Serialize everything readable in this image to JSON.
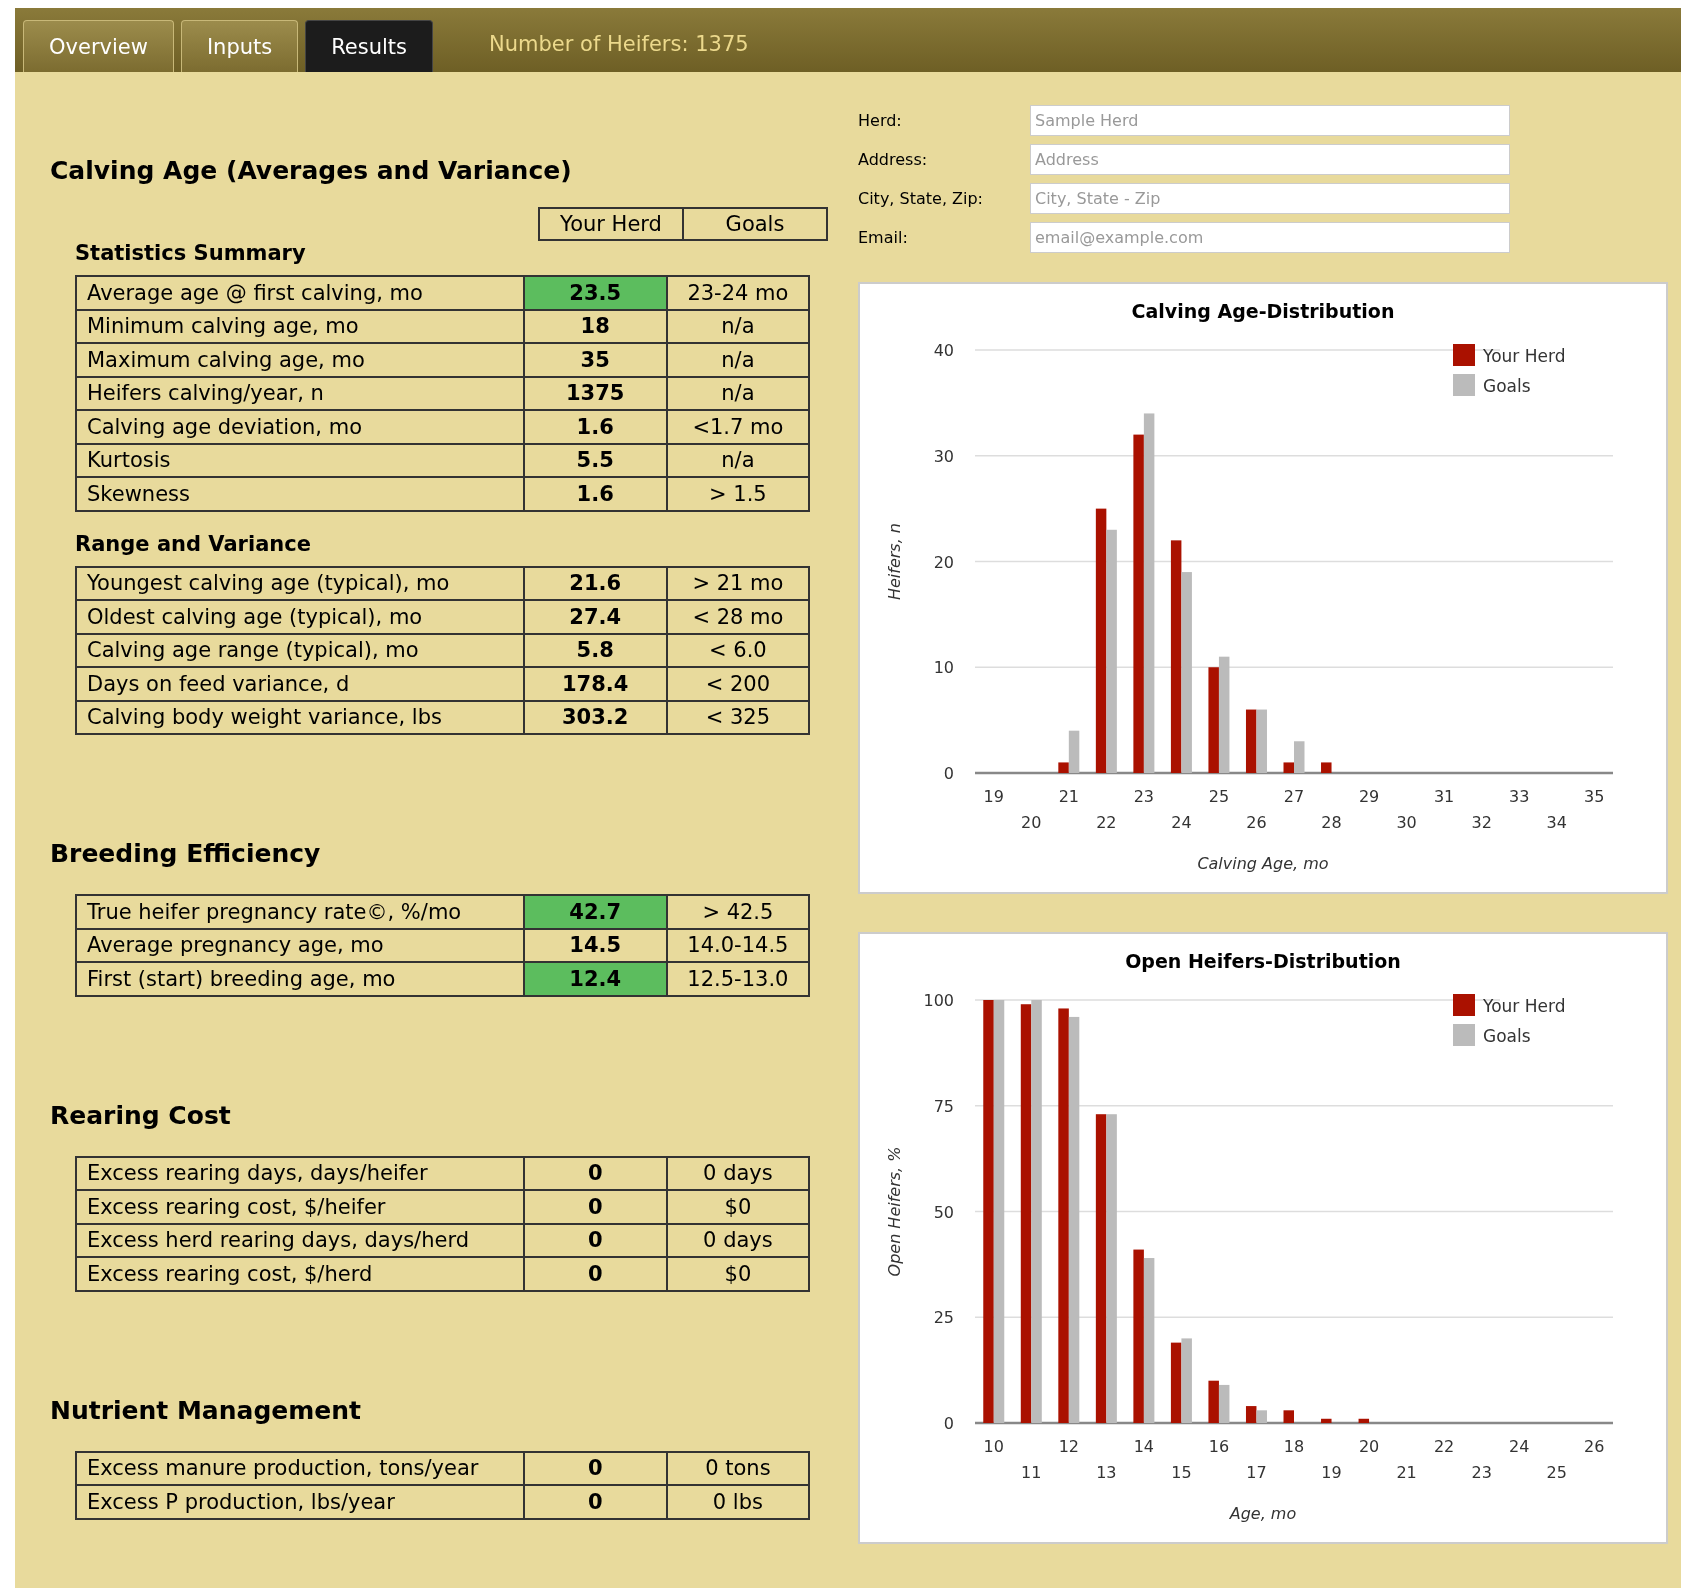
{
  "tabs": [
    {
      "label": "Overview",
      "selected": false
    },
    {
      "label": "Inputs",
      "selected": false
    },
    {
      "label": "Results",
      "selected": true
    }
  ],
  "heifer_count": "Number of Heifers: 1375",
  "form": {
    "fields": [
      {
        "label": "Herd:",
        "placeholder": "Sample Herd"
      },
      {
        "label": "Address:",
        "placeholder": "Address"
      },
      {
        "label": "City, State, Zip:",
        "placeholder": "City, State - Zip"
      },
      {
        "label": "Email:",
        "placeholder": "email@example.com"
      }
    ]
  },
  "column_headers": [
    "Your Herd",
    "Goals"
  ],
  "sections": [
    {
      "title": "Calving Age (Averages and Variance)",
      "groups": [
        {
          "subtitle": "Statistics Summary",
          "rows": [
            {
              "label": "Average age @ first calving, mo",
              "value": "23.5",
              "goal": "23-24 mo",
              "highlight": true
            },
            {
              "label": "Minimum calving age, mo",
              "value": "18",
              "goal": "n/a",
              "highlight": false
            },
            {
              "label": "Maximum calving age, mo",
              "value": "35",
              "goal": "n/a",
              "highlight": false
            },
            {
              "label": "Heifers calving/year, n",
              "value": "1375",
              "goal": "n/a",
              "highlight": false
            },
            {
              "label": "Calving age deviation, mo",
              "value": "1.6",
              "goal": "<1.7 mo",
              "highlight": false
            },
            {
              "label": "Kurtosis",
              "value": "5.5",
              "goal": "n/a",
              "highlight": false
            },
            {
              "label": "Skewness",
              "value": "1.6",
              "goal": "> 1.5",
              "highlight": false
            }
          ]
        },
        {
          "subtitle": "Range and Variance",
          "rows": [
            {
              "label": "Youngest calving age (typical), mo",
              "value": "21.6",
              "goal": "> 21 mo",
              "highlight": false
            },
            {
              "label": "Oldest calving age (typical), mo",
              "value": "27.4",
              "goal": "< 28 mo",
              "highlight": false
            },
            {
              "label": "Calving age range (typical), mo",
              "value": "5.8",
              "goal": "< 6.0",
              "highlight": false
            },
            {
              "label": "Days on feed variance, d",
              "value": "178.4",
              "goal": "< 200",
              "highlight": false
            },
            {
              "label": "Calving body weight variance, lbs",
              "value": "303.2",
              "goal": "< 325",
              "highlight": false
            }
          ]
        }
      ]
    },
    {
      "title": "Breeding Efficiency",
      "groups": [
        {
          "rows": [
            {
              "label": "True heifer pregnancy rate©, %/mo",
              "value": "42.7",
              "goal": "> 42.5",
              "highlight": true
            },
            {
              "label": "Average pregnancy age, mo",
              "value": "14.5",
              "goal": "14.0-14.5",
              "highlight": false
            },
            {
              "label": "First (start) breeding age, mo",
              "value": "12.4",
              "goal": "12.5-13.0",
              "highlight": true
            }
          ]
        }
      ]
    },
    {
      "title": "Rearing Cost",
      "groups": [
        {
          "rows": [
            {
              "label": "Excess rearing days, days/heifer",
              "value": "0",
              "goal": "0 days",
              "highlight": false
            },
            {
              "label": "Excess rearing cost, $/heifer",
              "value": "0",
              "goal": "$0",
              "highlight": false
            },
            {
              "label": "Excess herd rearing days, days/herd",
              "value": "0",
              "goal": "0 days",
              "highlight": false
            },
            {
              "label": "Excess rearing cost, $/herd",
              "value": "0",
              "goal": "$0",
              "highlight": false
            }
          ]
        }
      ]
    },
    {
      "title": "Nutrient Management",
      "groups": [
        {
          "rows": [
            {
              "label": "Excess manure production, tons/year",
              "value": "0",
              "goal": "0 tons",
              "highlight": false
            },
            {
              "label": "Excess P production, lbs/year",
              "value": "0",
              "goal": "0 lbs",
              "highlight": false
            }
          ]
        }
      ]
    }
  ],
  "charts": [
    {
      "chart_data": {
        "type": "bar",
        "title": "Calving Age-Distribution",
        "xlabel": "Calving Age, mo",
        "ylabel": "Heifers, n",
        "categories": [
          "19",
          "20",
          "21",
          "22",
          "23",
          "24",
          "25",
          "26",
          "27",
          "28",
          "29",
          "30",
          "31",
          "32",
          "33",
          "34",
          "35"
        ],
        "series": [
          {
            "name": "Your Herd",
            "color": "#aa1100",
            "values": [
              0,
              0,
              1,
              25,
              32,
              22,
              10,
              6,
              1,
              1,
              0,
              0,
              0,
              0,
              0,
              0,
              0
            ]
          },
          {
            "name": "Goals",
            "color": "#bbbbbb",
            "values": [
              0,
              0,
              4,
              23,
              34,
              19,
              11,
              6,
              3,
              0,
              0,
              0,
              0,
              0,
              0,
              0,
              0
            ]
          }
        ],
        "ylim": [
          0,
          40
        ],
        "yticks": [
          0,
          10,
          20,
          30,
          40
        ],
        "grid": true,
        "legend": true
      }
    },
    {
      "chart_data": {
        "type": "bar",
        "title": "Open Heifers-Distribution",
        "xlabel": "Age, mo",
        "ylabel": "Open Heifers, %",
        "categories": [
          "10",
          "11",
          "12",
          "13",
          "14",
          "15",
          "16",
          "17",
          "18",
          "19",
          "20",
          "21",
          "22",
          "23",
          "24",
          "25",
          "26"
        ],
        "series": [
          {
            "name": "Your Herd",
            "color": "#aa1100",
            "values": [
              100,
              99,
              98,
              73,
              41,
              19,
              10,
              4,
              3,
              1,
              1,
              0,
              0,
              0,
              0,
              0,
              0
            ]
          },
          {
            "name": "Goals",
            "color": "#bbbbbb",
            "values": [
              100,
              100,
              96,
              73,
              39,
              20,
              9,
              3,
              0,
              0,
              0,
              0,
              0,
              0,
              0,
              0,
              0
            ]
          }
        ],
        "ylim": [
          0,
          100
        ],
        "yticks": [
          0,
          25,
          50,
          75,
          100
        ],
        "grid": true,
        "legend": true
      }
    }
  ]
}
